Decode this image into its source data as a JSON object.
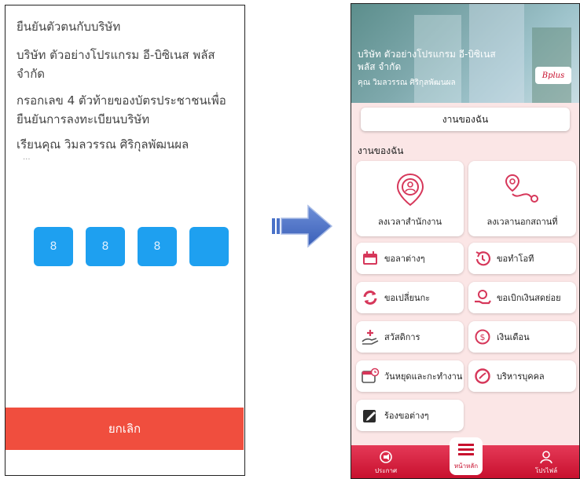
{
  "left_screen": {
    "title": "ยืนยันตัวตนกับบริษัท",
    "company_line1": "บริษัท ตัวอย่างโปรแกรม อี-บิซิเนส พลัส",
    "company_line2": "จำกัด",
    "instruction_line1": "กรอกเลข 4 ตัวท้ายของบัตรประชาชนเพื่อ",
    "instruction_line2": "ยืนยันการลงทะเบียนบริษัท",
    "greeting": "เรียนคุณ วิมลวรรณ ศิริกุลพัฒนผล",
    "ellipsis": "...",
    "pin_digits": [
      "8",
      "8",
      "8",
      ""
    ],
    "cancel_label": "ยกเลิก"
  },
  "right_screen": {
    "company_line1": "บริษัท ตัวอย่างโปรแกรม อี-บิซิเนส",
    "company_line2": "พลัส  จำกัด",
    "person": "คุณ วิมลวรรณ ศิริกุลพัฒนผล",
    "logo_text": "Bplus",
    "my_work_button": "งานของฉัน",
    "section_title": "งานของฉัน",
    "big_cards": [
      "ลงเวลาสำนักงาน",
      "ลงเวลานอกสถานที่"
    ],
    "menu": [
      "ขอลาต่างๆ",
      "ขอทำโอที",
      "ขอเปลี่ยนกะ",
      "ขอเบิกเงินสดย่อย",
      "สวัสดิการ",
      "เงินเดือน",
      "วันหยุดและกะทำงาน",
      "บริหารบุคคล",
      "ร้องขอต่างๆ"
    ],
    "nav": {
      "announce": "ประกาศ",
      "home": "หน้าหลัก",
      "profile": "โปรไฟล์"
    }
  },
  "colors": {
    "pin_blue": "#1ea0f0",
    "cancel_red": "#f04e3e",
    "brand_red": "#c8102e",
    "arrow_blue": "#4a72c8"
  }
}
